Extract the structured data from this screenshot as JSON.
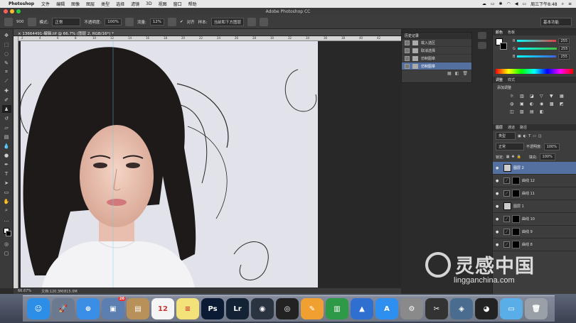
{
  "menubar": {
    "app_name": "Photoshop",
    "items": [
      "文件",
      "编辑",
      "图像",
      "图层",
      "类型",
      "选择",
      "滤镜",
      "3D",
      "视图",
      "窗口",
      "帮助"
    ],
    "clock": "周三下午8:48"
  },
  "window": {
    "title": "Adobe Photoshop CC"
  },
  "options": {
    "brush_size": "900",
    "mode_label": "模式:",
    "mode_value": "正常",
    "opacity_label": "不透明度:",
    "opacity_value": "100%",
    "flow_label": "流量:",
    "flow_value": "12%",
    "aligned_label": "对齐",
    "sample_label": "样本:",
    "sample_value": "当前和下方图层",
    "workspace": "基本功能"
  },
  "document": {
    "tab": "13664491-编辑.tif @ 66.7% (图层 2, RGB/16*) *",
    "zoom": "66.67%",
    "doc_size": "文档:120.3M/815.0M",
    "ruler_marks": [
      "2",
      "4",
      "6",
      "8",
      "10",
      "12",
      "14",
      "16",
      "18",
      "20",
      "22",
      "24",
      "26",
      "28",
      "30",
      "32",
      "34",
      "36",
      "38",
      "40",
      "42"
    ]
  },
  "history": {
    "title": "历史记录",
    "items": [
      {
        "label": "载入选区",
        "selected": false
      },
      {
        "label": "取消选择",
        "selected": false
      },
      {
        "label": "仿制图章",
        "selected": false
      },
      {
        "label": "仿制图章",
        "selected": true
      }
    ]
  },
  "color_panel": {
    "tabs": [
      "颜色",
      "色板"
    ],
    "channels": [
      {
        "name": "R",
        "value": "255",
        "color": "#e04040"
      },
      {
        "name": "G",
        "value": "255",
        "color": "#40c040"
      },
      {
        "name": "B",
        "value": "255",
        "color": "#4060e0"
      }
    ]
  },
  "adjust_panel": {
    "tabs": [
      "调整",
      "样式"
    ],
    "title": "添加调整",
    "icons_row1": [
      "☼",
      "▥",
      "◪",
      "▽",
      "▼"
    ],
    "icons_row2": [
      "▦",
      "◍",
      "▣",
      "◐",
      "◉",
      "▩"
    ],
    "icons_row3": [
      "◩",
      "◫",
      "▨",
      "▤",
      "◧"
    ]
  },
  "layers_panel": {
    "tabs": [
      "图层",
      "通道",
      "路径"
    ],
    "kind": "类型",
    "blend": "正常",
    "opacity_label": "不透明度:",
    "opacity": "100%",
    "lock_label": "锁定:",
    "fill_label": "填充:",
    "fill": "100%",
    "layers": [
      {
        "name": "图层 2",
        "type": "pixel",
        "selected": true
      },
      {
        "name": "曲线 12",
        "type": "curves",
        "selected": false
      },
      {
        "name": "曲线 11",
        "type": "curves",
        "selected": false
      },
      {
        "name": "图层 1",
        "type": "pixel",
        "selected": false
      },
      {
        "name": "曲线 10",
        "type": "curves",
        "selected": false
      },
      {
        "name": "曲线 9",
        "type": "curves",
        "selected": false
      },
      {
        "name": "曲线 8",
        "type": "curves",
        "selected": false
      }
    ]
  },
  "dock": {
    "apps": [
      {
        "name": "finder",
        "glyph": "☺",
        "color": "#2d8ee8"
      },
      {
        "name": "launchpad",
        "glyph": "🚀",
        "color": "#6b7a8f"
      },
      {
        "name": "safari",
        "glyph": "⊕",
        "color": "#3a8ee6"
      },
      {
        "name": "photos",
        "glyph": "▣",
        "color": "#5a7fb0",
        "badge": "26"
      },
      {
        "name": "notes-book",
        "glyph": "▤",
        "color": "#b8905a"
      },
      {
        "name": "calendar",
        "glyph": "12",
        "color": "#f5f5f5"
      },
      {
        "name": "stickies",
        "glyph": "≡",
        "color": "#f3e27a"
      },
      {
        "name": "photoshop",
        "glyph": "Ps",
        "color": "#0a1b33"
      },
      {
        "name": "lightroom",
        "glyph": "Lr",
        "color": "#132235"
      },
      {
        "name": "camera-app",
        "glyph": "◉",
        "color": "#2a3340"
      },
      {
        "name": "aperture",
        "glyph": "◎",
        "color": "#222"
      },
      {
        "name": "pages",
        "glyph": "✎",
        "color": "#f0a030"
      },
      {
        "name": "numbers",
        "glyph": "▥",
        "color": "#2e9a48"
      },
      {
        "name": "keynote",
        "glyph": "▲",
        "color": "#2f6fd0"
      },
      {
        "name": "app-store",
        "glyph": "A",
        "color": "#2f8ff0"
      },
      {
        "name": "system-preferences",
        "glyph": "⚙",
        "color": "#8a8a8a"
      },
      {
        "name": "final-cut",
        "glyph": "✂",
        "color": "#333"
      },
      {
        "name": "iphoto",
        "glyph": "◈",
        "color": "#4a6d8f"
      },
      {
        "name": "qq",
        "glyph": "◕",
        "color": "#222"
      },
      {
        "name": "downloads-folder",
        "glyph": "▭",
        "color": "#5aaee8"
      },
      {
        "name": "trash",
        "glyph": "🗑",
        "color": "#9aa0a8"
      }
    ]
  },
  "watermark": {
    "text": "灵感中国",
    "url": "lingganchina.com"
  }
}
